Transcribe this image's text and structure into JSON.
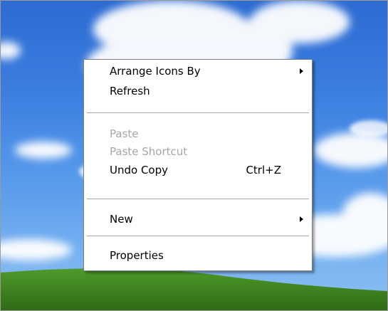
{
  "colors": {
    "menu_background": "#ffffff",
    "menu_border": "#7d7d7d",
    "disabled_text": "#a6a6a6",
    "sky": "#3b7fe0",
    "hill": "#3a7f1e"
  },
  "context_menu": {
    "items": [
      {
        "label": "Arrange Icons By",
        "submenu": true
      },
      {
        "label": "Refresh"
      },
      {
        "label": "Paste",
        "disabled": true
      },
      {
        "label": "Paste Shortcut",
        "disabled": true
      },
      {
        "label": "Undo Copy",
        "shortcut": "Ctrl+Z"
      },
      {
        "label": "New",
        "submenu": true
      },
      {
        "label": "Properties"
      }
    ],
    "submenu_arrow_icon": "triangle-right-icon"
  }
}
